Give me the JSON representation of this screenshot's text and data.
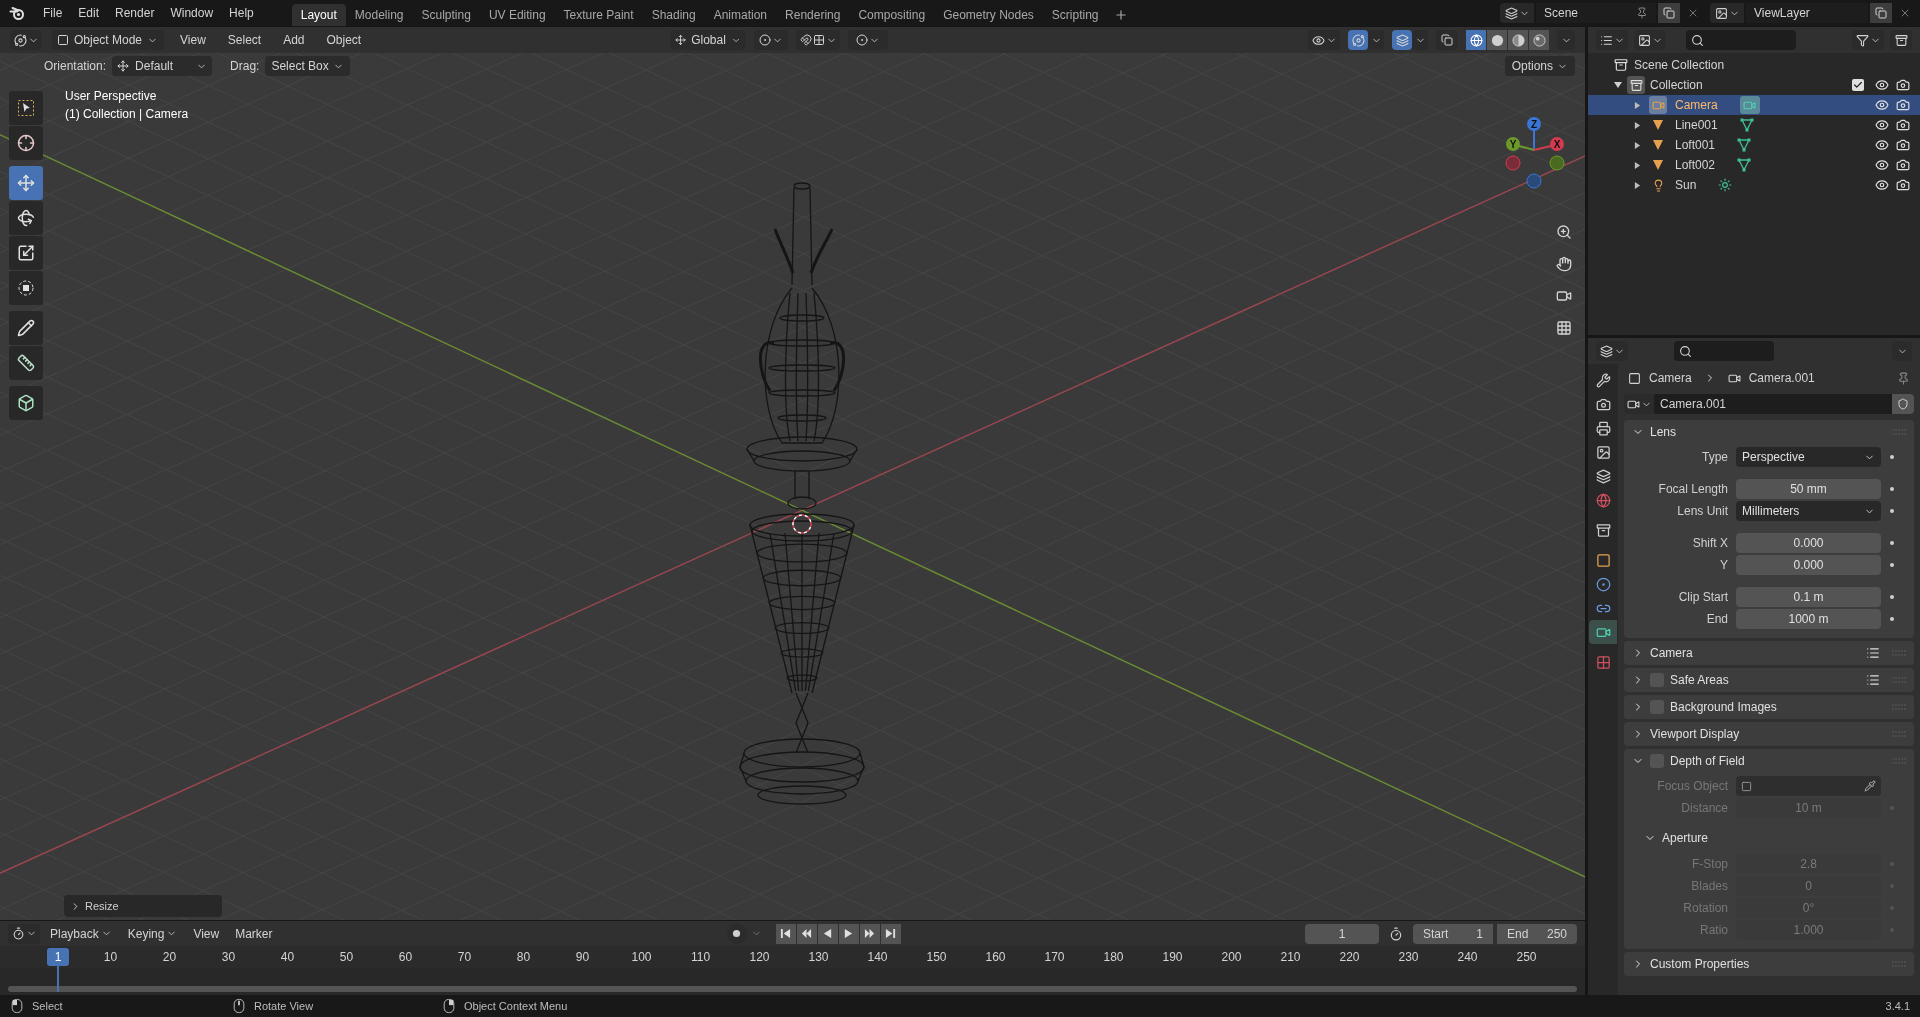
{
  "menu": [
    "File",
    "Edit",
    "Render",
    "Window",
    "Help"
  ],
  "workspaces": [
    {
      "label": "Layout",
      "selected": true
    },
    {
      "label": "Modeling",
      "selected": false
    },
    {
      "label": "Sculpting",
      "selected": false
    },
    {
      "label": "UV Editing",
      "selected": false
    },
    {
      "label": "Texture Paint",
      "selected": false
    },
    {
      "label": "Shading",
      "selected": false
    },
    {
      "label": "Animation",
      "selected": false
    },
    {
      "label": "Rendering",
      "selected": false
    },
    {
      "label": "Compositing",
      "selected": false
    },
    {
      "label": "Geometry Nodes",
      "selected": false
    },
    {
      "label": "Scripting",
      "selected": false
    }
  ],
  "scene": "Scene",
  "view_layer": "ViewLayer",
  "viewport_header": {
    "mode": "Object Mode",
    "menus": [
      "View",
      "Select",
      "Add",
      "Object"
    ],
    "orientation": "Global",
    "shading": [
      {
        "kind": "wireframe",
        "selected": true
      },
      {
        "kind": "solid",
        "selected": false
      },
      {
        "kind": "material",
        "selected": false
      },
      {
        "kind": "rendered",
        "selected": false
      }
    ]
  },
  "tool_settings": {
    "orientation_label": "Orientation:",
    "orientation": "Default",
    "drag_label": "Drag:",
    "drag": "Select Box",
    "options": "Options"
  },
  "toolbar": [
    [
      {
        "kind": "select",
        "selected": false
      },
      {
        "kind": "cursor",
        "selected": false
      }
    ],
    [
      {
        "kind": "move",
        "selected": true
      },
      {
        "kind": "rotate",
        "selected": false
      },
      {
        "kind": "scale",
        "selected": false
      },
      {
        "kind": "transform",
        "selected": false
      }
    ],
    [
      {
        "kind": "annotate",
        "selected": false
      },
      {
        "kind": "measure",
        "selected": false
      }
    ],
    [
      {
        "kind": "addcube",
        "selected": false
      }
    ]
  ],
  "viewport": {
    "view_name": "User Perspective",
    "context": "(1) Collection | Camera",
    "gizmo": {
      "x": "X",
      "y": "Y",
      "z": "Z"
    },
    "last_operator": "Resize"
  },
  "outliner": {
    "root": "Scene Collection",
    "collections": [
      {
        "name": "Collection",
        "expanded": true,
        "checked": true,
        "children": [
          {
            "name": "Camera",
            "kind": "camera",
            "selected": true
          },
          {
            "name": "Line001",
            "kind": "mesh",
            "selected": false
          },
          {
            "name": "Loft001",
            "kind": "mesh",
            "selected": false
          },
          {
            "name": "Loft002",
            "kind": "mesh",
            "selected": false
          },
          {
            "name": "Sun",
            "kind": "light",
            "selected": false
          }
        ]
      }
    ]
  },
  "properties": {
    "tabs": [
      {
        "kind": "tool",
        "selected": false
      },
      {
        "kind": "render",
        "selected": false
      },
      {
        "kind": "output",
        "selected": false
      },
      {
        "kind": "viewlayer",
        "selected": false
      },
      {
        "kind": "scene",
        "selected": false
      },
      {
        "kind": "world",
        "selected": false
      },
      {
        "kind": "collection",
        "selected": false
      },
      {
        "kind": "object",
        "selected": false
      },
      {
        "kind": "physics",
        "selected": false
      },
      {
        "kind": "constraints",
        "selected": false
      },
      {
        "kind": "data",
        "selected": true
      },
      {
        "kind": "texture",
        "selected": false
      }
    ],
    "breadcrumb": [
      "Camera",
      "Camera.001"
    ],
    "datablock": "Camera.001",
    "panels": [
      {
        "title": "Lens",
        "expanded": true,
        "presets": false,
        "groups": [
          [
            {
              "label": "Type",
              "value": "Perspective",
              "kind": "dropdown",
              "disabled": false
            }
          ],
          [
            {
              "label": "Focal Length",
              "value": "50 mm",
              "kind": "number",
              "disabled": false
            },
            {
              "label": "Lens Unit",
              "value": "Millimeters",
              "kind": "dropdown",
              "disabled": false
            }
          ],
          [
            {
              "label": "Shift X",
              "value": "0.000",
              "kind": "number",
              "disabled": false
            },
            {
              "label": "Y",
              "value": "0.000",
              "kind": "number",
              "disabled": false
            }
          ],
          [
            {
              "label": "Clip Start",
              "value": "0.1 m",
              "kind": "number",
              "disabled": false
            },
            {
              "label": "End",
              "value": "1000 m",
              "kind": "number",
              "disabled": false
            }
          ]
        ]
      },
      {
        "title": "Camera",
        "expanded": false,
        "presets": true
      },
      {
        "title": "Safe Areas",
        "expanded": false,
        "presets": true,
        "checkbox": {
          "checked": false
        }
      },
      {
        "title": "Background Images",
        "expanded": false,
        "presets": false,
        "checkbox": {
          "checked": false
        }
      },
      {
        "title": "Viewport Display",
        "expanded": false,
        "presets": false
      },
      {
        "title": "Depth of Field",
        "expanded": true,
        "presets": false,
        "checkbox": {
          "checked": false
        },
        "groups": [
          [
            {
              "label": "Focus Object",
              "kind": "object",
              "disabled": true
            },
            {
              "label": "Distance",
              "value": "10 m",
              "kind": "number",
              "disabled": true
            }
          ]
        ],
        "subpanels": [
          {
            "title": "Aperture",
            "expanded": true,
            "groups": [
              [
                {
                  "label": "F-Stop",
                  "value": "2.8",
                  "kind": "number",
                  "disabled": true
                },
                {
                  "label": "Blades",
                  "value": "0",
                  "kind": "number",
                  "disabled": true
                },
                {
                  "label": "Rotation",
                  "value": "0°",
                  "kind": "number",
                  "disabled": true
                },
                {
                  "label": "Ratio",
                  "value": "1.000",
                  "kind": "number",
                  "disabled": true
                }
              ]
            ]
          }
        ]
      },
      {
        "title": "Custom Properties",
        "expanded": false,
        "presets": false
      }
    ]
  },
  "timeline": {
    "menus": [
      "Playback",
      "Keying",
      "View",
      "Marker"
    ],
    "current_frame": "1",
    "start_label": "Start",
    "start": "1",
    "end_label": "End",
    "end": "250",
    "playhead": "1",
    "ruler": [
      "10",
      "20",
      "30",
      "40",
      "50",
      "60",
      "70",
      "80",
      "90",
      "100",
      "110",
      "120",
      "130",
      "140",
      "150",
      "160",
      "170",
      "180",
      "190",
      "200",
      "210",
      "220",
      "230",
      "240",
      "250"
    ]
  },
  "status": [
    {
      "kind": "left",
      "label": "Select"
    },
    {
      "kind": "middle",
      "label": "Rotate View"
    },
    {
      "kind": "right",
      "label": "Object Context Menu"
    }
  ],
  "version": "3.4.1"
}
